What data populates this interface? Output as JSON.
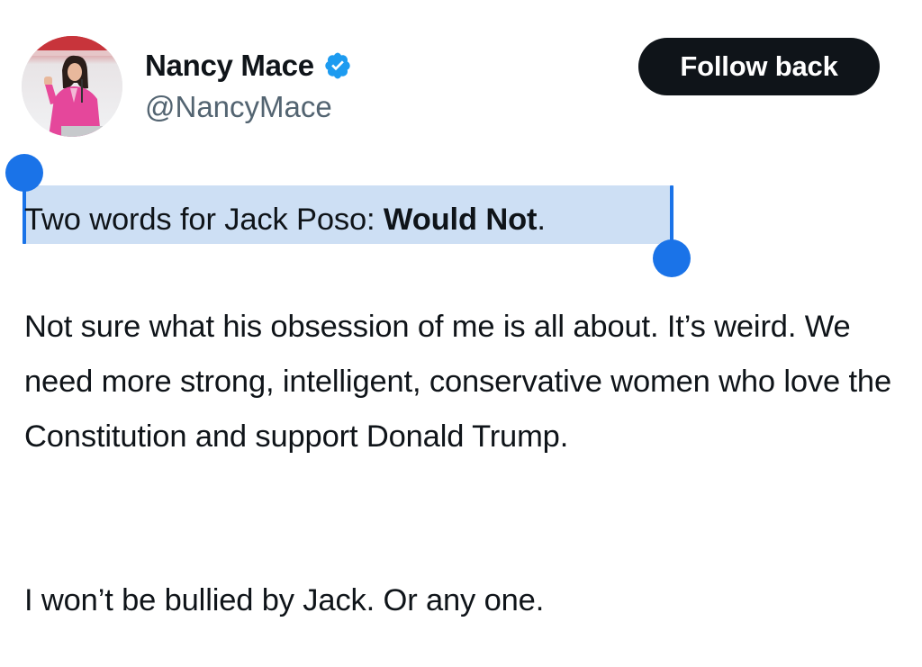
{
  "author": {
    "display_name": "Nancy Mace",
    "handle": "@NancyMace",
    "verified_icon": "verified-badge-icon",
    "avatar_icon": "profile-photo"
  },
  "actions": {
    "follow_label": "Follow back"
  },
  "tweet": {
    "line1_prefix": "Two words for Jack Poso: ",
    "line1_bold": "Would Not",
    "line1_suffix": ".",
    "paragraph2": "Not sure what his obsession of me is all about. It’s weird. We need more strong, intelligent, conservative women who love the Constitution and support Donald Trump.",
    "paragraph3": "I won’t be bullied by Jack. Or any one."
  },
  "selection": {
    "selected_text": "Two words for Jack Poso: Would Not"
  },
  "colors": {
    "text": "#0f1419",
    "secondary_text": "#536471",
    "follow_button": "#0f1419",
    "verified": "#1d9bf0",
    "selection_highlight": "#cddff4",
    "selection_handle": "#1a73e8"
  }
}
